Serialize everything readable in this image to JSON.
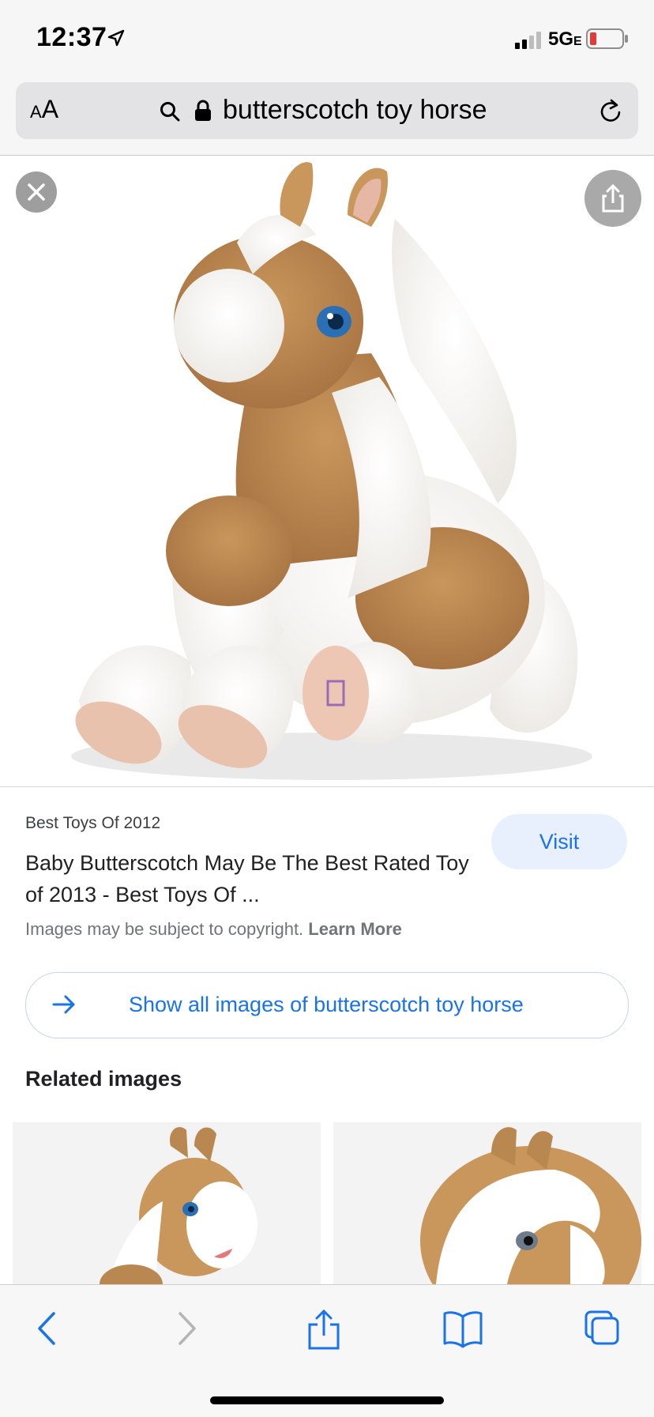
{
  "status": {
    "time": "12:37",
    "network": "5G",
    "network_suffix": "E"
  },
  "address_bar": {
    "text_size_label_small": "A",
    "text_size_label_large": "A",
    "url_text": "butterscotch toy horse"
  },
  "result": {
    "source": "Best Toys Of 2012",
    "title": "Baby Butterscotch May Be The Best Rated Toy of 2013 - Best Toys Of ...",
    "copyright": "Images may be subject to copyright.",
    "learn_more": "Learn More",
    "visit_label": "Visit"
  },
  "show_all": {
    "label": "Show all images of butterscotch toy horse"
  },
  "related": {
    "heading": "Related images"
  },
  "colors": {
    "accent": "#1a73e8",
    "visit_bg": "#e8f0fe",
    "battery_low": "#e53935"
  },
  "icons": [
    "location-arrow-icon",
    "signal-icon",
    "battery-icon",
    "search-icon",
    "lock-icon",
    "reload-icon",
    "close-icon",
    "share-icon",
    "arrow-right-icon",
    "back-icon",
    "forward-icon",
    "bookmarks-icon",
    "tabs-icon"
  ]
}
